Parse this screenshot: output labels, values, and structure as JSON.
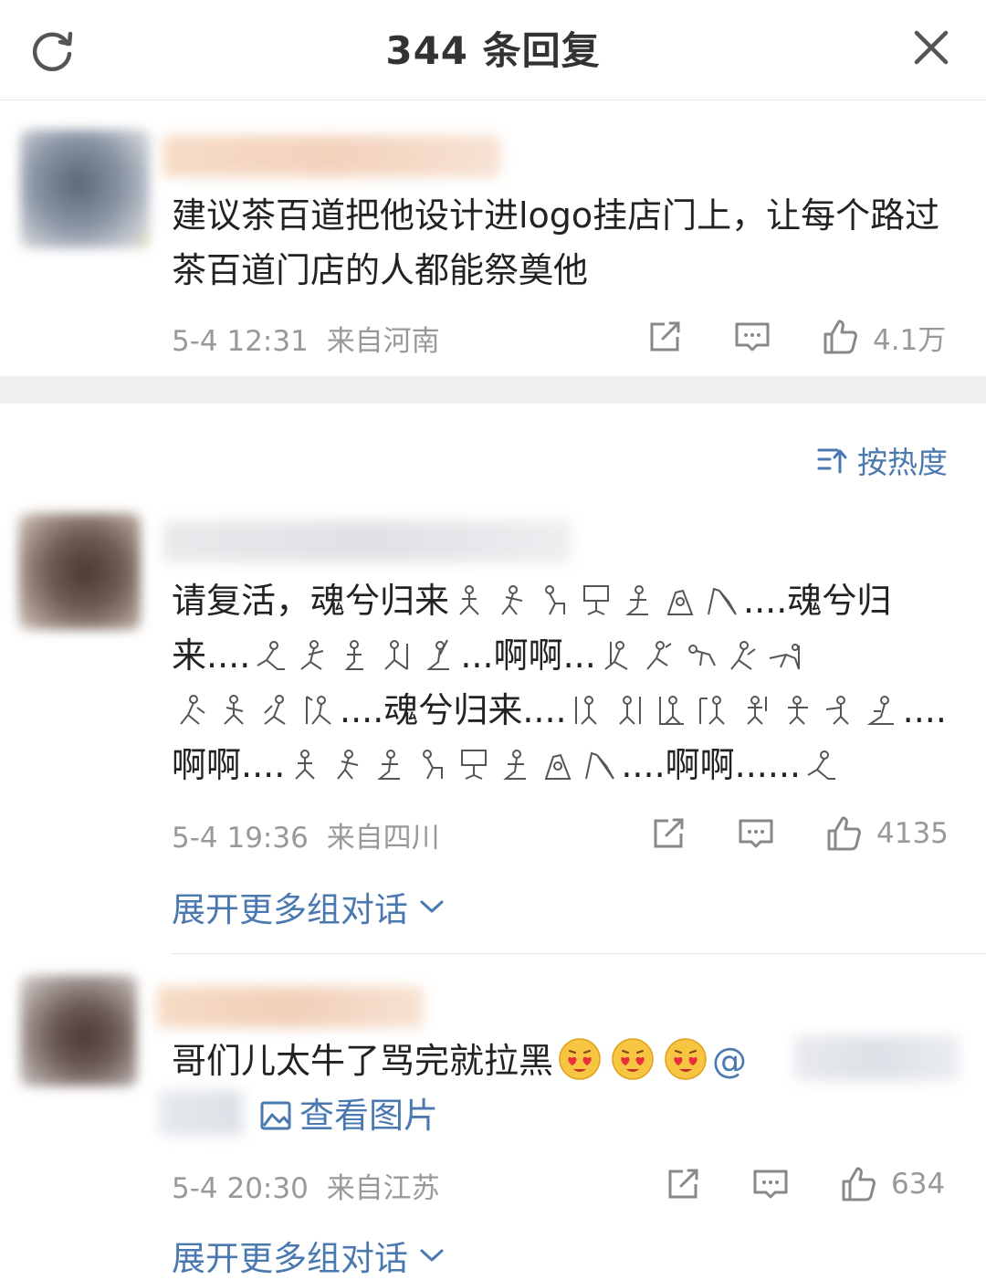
{
  "header": {
    "title": "344 条回复",
    "refresh_icon": "refresh-icon",
    "close_icon": "close-icon"
  },
  "main_comment": {
    "text": "建议茶百道把他设计进logo挂店门上，让每个路过茶百道门店的人都能祭奠他",
    "time": "5-4 12:31",
    "location": "来自河南",
    "likes": "4.1万"
  },
  "sort": {
    "label": "按热度",
    "icon": "sort-icon"
  },
  "replies": [
    {
      "seg1": "请复活，魂兮归来",
      "seg2": "....魂兮归来....",
      "seg3": "...啊啊...",
      "seg4": "....魂兮归来....",
      "seg5": "....啊啊....",
      "seg6": "....啊啊......",
      "time": "5-4 19:36",
      "location": "来自四川",
      "likes": "4135",
      "expand": "展开更多组对话"
    },
    {
      "text": "哥们儿太牛了骂完就拉黑",
      "mention": "@",
      "image_link": "查看图片",
      "time": "5-4 20:30",
      "location": "来自江苏",
      "likes": "634",
      "expand": "展开更多组对话"
    }
  ],
  "colors": {
    "link": "#4a78b0",
    "meta": "#999999",
    "separator": "#efefef"
  }
}
